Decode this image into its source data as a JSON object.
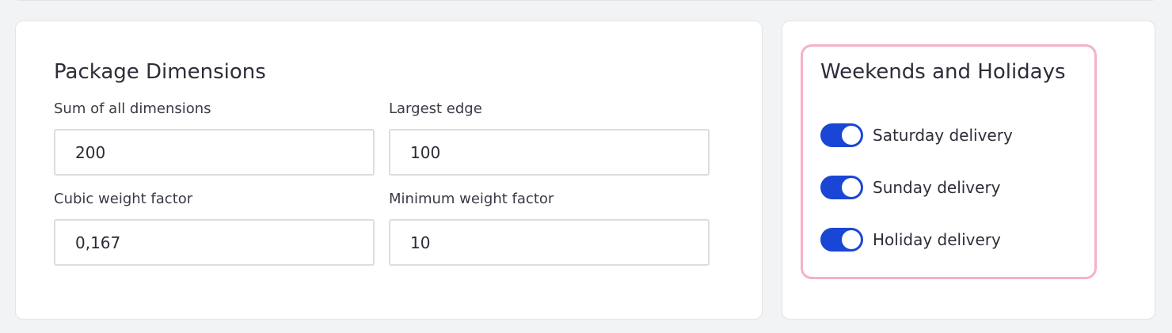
{
  "dimensions": {
    "title": "Package Dimensions",
    "fields": [
      {
        "label": "Sum of all dimensions",
        "value": "200"
      },
      {
        "label": "Largest edge",
        "value": "100"
      },
      {
        "label": "Cubic weight factor",
        "value": "0,167"
      },
      {
        "label": "Minimum weight factor",
        "value": "10"
      }
    ]
  },
  "weekends": {
    "title": "Weekends and Holidays",
    "toggles": [
      {
        "label": "Saturday delivery",
        "on": true
      },
      {
        "label": "Sunday delivery",
        "on": true
      },
      {
        "label": "Holiday delivery",
        "on": true
      }
    ]
  },
  "colors": {
    "toggle_on": "#1a46d6",
    "highlight_border": "#f5b1c8",
    "background": "#f2f3f5"
  }
}
